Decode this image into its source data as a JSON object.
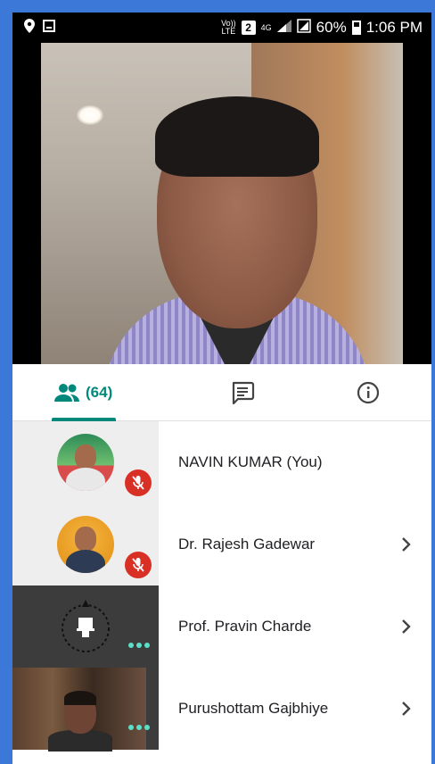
{
  "statusbar": {
    "network_label": "LTE",
    "volte_label": "Vo))",
    "sim_slot": "2",
    "signal_label": "4G",
    "battery_percent": "60%",
    "time": "1:06 PM"
  },
  "tabs": [
    {
      "name": "people",
      "count_label": "(64)",
      "icon": "people-icon",
      "active": true
    },
    {
      "name": "chat",
      "icon": "chat-icon",
      "active": false
    },
    {
      "name": "info",
      "icon": "info-icon",
      "active": false
    }
  ],
  "participants": [
    {
      "name": "NAVIN KUMAR (You)",
      "muted": true,
      "has_chevron": false,
      "thumb": "avatar"
    },
    {
      "name": "Dr. Rajesh Gadewar",
      "muted": true,
      "has_chevron": true,
      "thumb": "avatar"
    },
    {
      "name": "Prof. Pravin Charde",
      "muted": false,
      "has_chevron": true,
      "thumb": "logo"
    },
    {
      "name": "Purushottam Gajbhiye",
      "muted": false,
      "has_chevron": true,
      "thumb": "video"
    }
  ],
  "colors": {
    "accent": "#00897b",
    "mute": "#d93025",
    "speaking_dots": "#5be0c8",
    "frame": "#3c78d8"
  }
}
